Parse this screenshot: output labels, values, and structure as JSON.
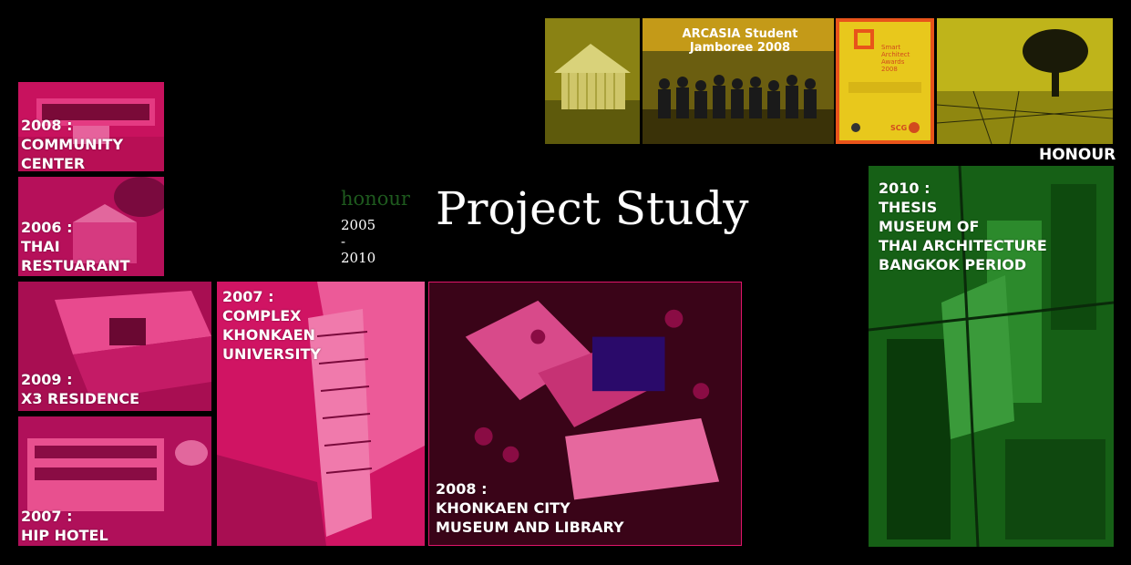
{
  "title": {
    "honour": "honour",
    "years": "2005 - 2010",
    "main": "Project Study"
  },
  "honour_label": "HONOUR",
  "honour_gallery": {
    "jamboree_banner": "ARCASIA Student Jamboree 2008",
    "award_text": "Smart\nArchitect\nAwards\n2008",
    "award_logo": "SCG"
  },
  "projects": {
    "community_center": "2008 :\nCOMMUNITY\nCENTER",
    "thai_restaurant": "2006 :\nTHAI\nRESTUARANT",
    "x3_residence": "2009 :\nX3 RESIDENCE",
    "hip_hotel": "2007 :\nHIP HOTEL",
    "complex_khonkaen": "2007 :\nCOMPLEX\nKHONKAEN\nUNIVERSITY",
    "khonkaen_museum": "2008 :\nKHONKAEN CITY\nMUSEUM AND LIBRARY",
    "thesis": "2010 :\nTHESIS\nMUSEUM OF\nTHAI ARCHITECTURE\nBANGKOK PERIOD"
  },
  "colors": {
    "magenta": "#e0156a",
    "green": "#1f7a1f",
    "yellow": "#d8c81a"
  }
}
